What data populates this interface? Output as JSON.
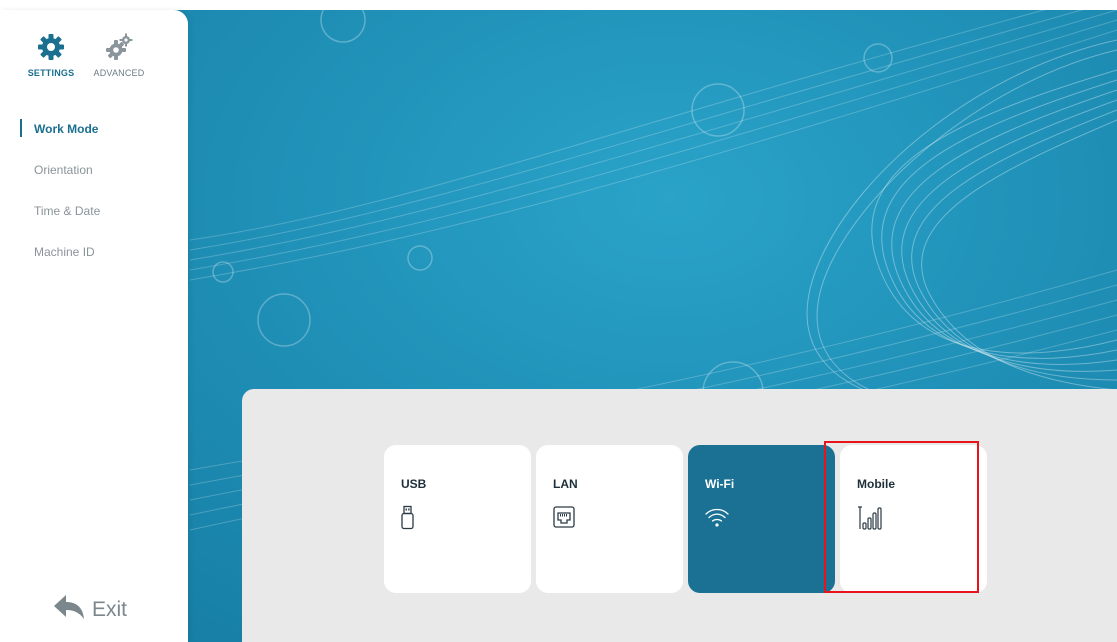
{
  "sidebar": {
    "tabs": [
      {
        "label": "SETTINGS",
        "icon": "gear-icon",
        "active": true
      },
      {
        "label": "ADVANCED",
        "icon": "gears-icon",
        "active": false
      }
    ],
    "menu": [
      {
        "label": "Work Mode",
        "active": true
      },
      {
        "label": "Orientation",
        "active": false
      },
      {
        "label": "Time & Date",
        "active": false
      },
      {
        "label": "Machine ID",
        "active": false
      }
    ],
    "exit_label": "Exit",
    "exit_icon": "back-arrow-icon"
  },
  "work_mode": {
    "options": [
      {
        "label": "USB",
        "icon": "usb-stick-icon",
        "selected": false
      },
      {
        "label": "LAN",
        "icon": "ethernet-port-icon",
        "selected": false
      },
      {
        "label": "Wi-Fi",
        "icon": "wifi-icon",
        "selected": true
      },
      {
        "label": "Mobile",
        "icon": "cellular-signal-icon",
        "selected": false
      }
    ]
  },
  "colors": {
    "accent": "#1b6f8f",
    "selected_card": "#1a7194",
    "background": "#1f8fb6",
    "highlight_outline": "#e8141b"
  }
}
